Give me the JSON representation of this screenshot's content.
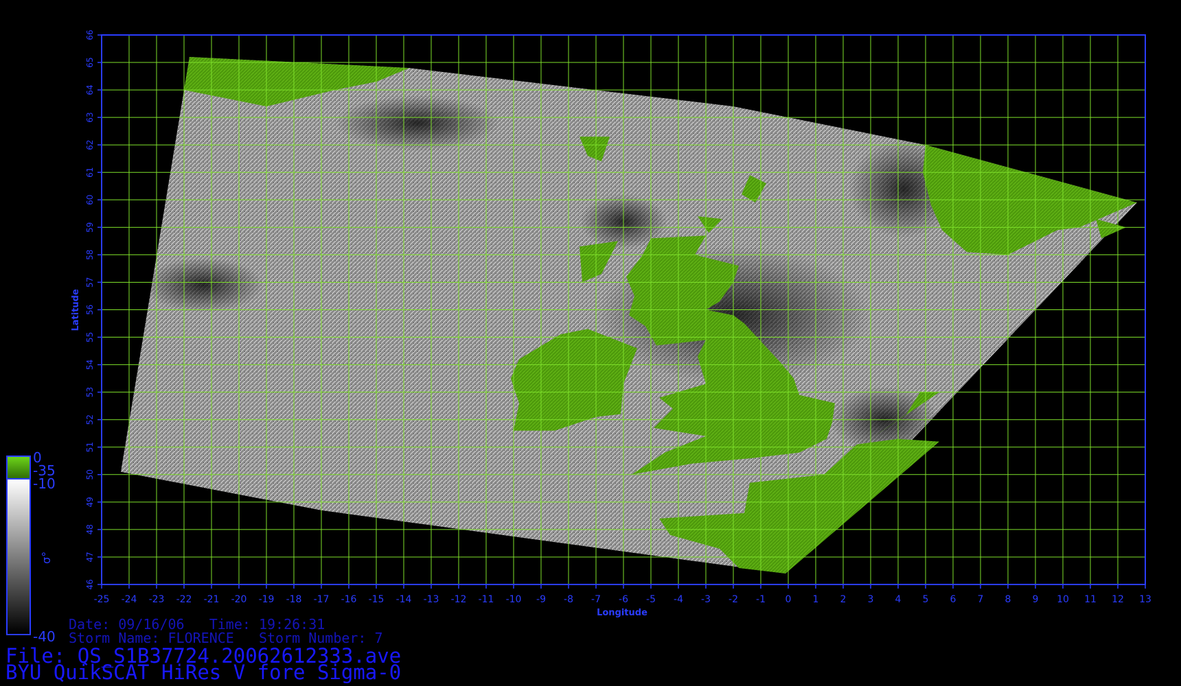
{
  "map": {
    "lon_range": [
      -25,
      13
    ],
    "lat_range": [
      46,
      66
    ],
    "lon_ticks": [
      "-25",
      "-24",
      "-23",
      "-22",
      "-21",
      "-20",
      "-19",
      "-18",
      "-17",
      "-16",
      "-15",
      "-14",
      "-13",
      "-12",
      "-11",
      "-10",
      "-9",
      "-8",
      "-7",
      "-6",
      "-5",
      "-4",
      "-3",
      "-2",
      "-1",
      "0",
      "1",
      "2",
      "3",
      "4",
      "5",
      "6",
      "7",
      "8",
      "9",
      "10",
      "11",
      "12",
      "13"
    ],
    "lat_ticks": [
      "46",
      "47",
      "48",
      "49",
      "50",
      "51",
      "52",
      "53",
      "54",
      "55",
      "56",
      "57",
      "58",
      "59",
      "60",
      "61",
      "62",
      "63",
      "64",
      "65",
      "66"
    ],
    "xlabel": "Longitude",
    "ylabel": "Latitude",
    "grid": true,
    "colors": {
      "grid": "#7ee02a",
      "axis": "#2a3cff",
      "land": "#4e9a0c",
      "background": "#000000"
    }
  },
  "colorbar": {
    "labels": [
      "0",
      "-35",
      "-10",
      "-40"
    ],
    "symbol": "σ°"
  },
  "info": {
    "date_line": "Date: 09/16/06   Time: 19:26:31",
    "storm_line": "Storm Name: FLORENCE   Storm Number: 7",
    "file_line": "File: QS_S1B37724.20062612333.ave",
    "product_line": "BYU QuikSCAT HiRes V fore Sigma-0"
  }
}
